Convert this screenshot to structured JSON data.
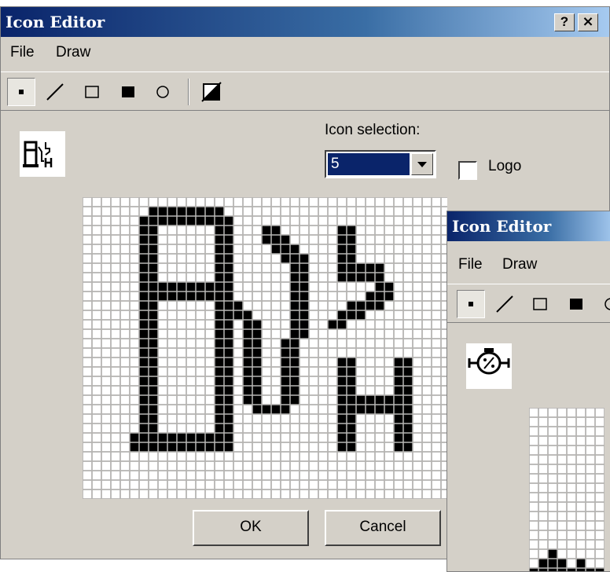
{
  "window": {
    "title": "Icon Editor",
    "help_button": "?",
    "close_button": "x",
    "menu": [
      "File",
      "Draw"
    ],
    "tools": [
      "pixel-tool",
      "line-tool",
      "rectangle-tool",
      "filled-rectangle-tool",
      "ellipse-tool",
      "invert-tool"
    ],
    "icon_selection_label": "Icon selection:",
    "icon_selection_value": "5",
    "logo_label": "Logo",
    "logo_checked": false,
    "ok_label": "OK",
    "cancel_label": "Cancel",
    "icon_name": "fuel-pump-icon"
  },
  "window2": {
    "title": "Icon Editor",
    "menu": [
      "File",
      "Draw"
    ],
    "icon_name": "engine-icon"
  },
  "colors": {
    "titlebar_start": "#0a246a",
    "titlebar_end": "#a6caf0",
    "face": "#d4d0c8",
    "pixel_on": "#000000",
    "pixel_off": "#ffffff",
    "grid_line": "#a0a0a0"
  },
  "grid": {
    "rows": [
      "0000000000000000000000000000000000000000",
      "0000000111111110000000000000000000000000",
      "0000001111111111000000000000000000000000",
      "0000001100000011000110000001100000000000",
      "0000001100000011000111000001100000000000",
      "0000001100000011000011100001100000000000",
      "0000001100000011000001110001100000000000",
      "0000001100000011000000110001111100000000",
      "0000001100000011000000110001111100000000",
      "0000001111111111000000110000000110000000",
      "0000001111111111000000110000001110000000",
      "0000001100000011100000110000111100000000",
      "0000001100000011110000110001110000000000",
      "0000001100000011011000110011000000000000",
      "0000001100000011011000110000000000000000",
      "0000001100000011011001100000000000000000",
      "0000001100000011011001100000000000000000",
      "0000001100000011011001100001100001100000",
      "0000001100000011011001100001100001100000",
      "0000001100000011011001100001100001100000",
      "0000001100000011011001100001100001100000",
      "0000001100000011011001100001111111100000",
      "0000001100000011001111000001111111100000",
      "0000001100000011000000000001100001100000",
      "0000001100000011000000000001100001100000",
      "0000011111111111000000000001100001100000",
      "0000011111111111000000000001100001100000",
      "0000000000000000000000000000000000000000",
      "0000000000000000000000000000000000000000",
      "0000000000000000000000000000000000000000",
      "0000000000000000000000000000000000000000",
      "0000000000000000000000000000000000000000"
    ]
  },
  "grid2": {
    "rows": [
      "00000000",
      "00000000",
      "00000000",
      "00000000",
      "00000000",
      "00000000",
      "00000000",
      "00000000",
      "00000000",
      "00000000",
      "00000000",
      "00000000",
      "00000000",
      "00000000",
      "00000000",
      "00100000",
      "01110100",
      "11111111"
    ]
  }
}
